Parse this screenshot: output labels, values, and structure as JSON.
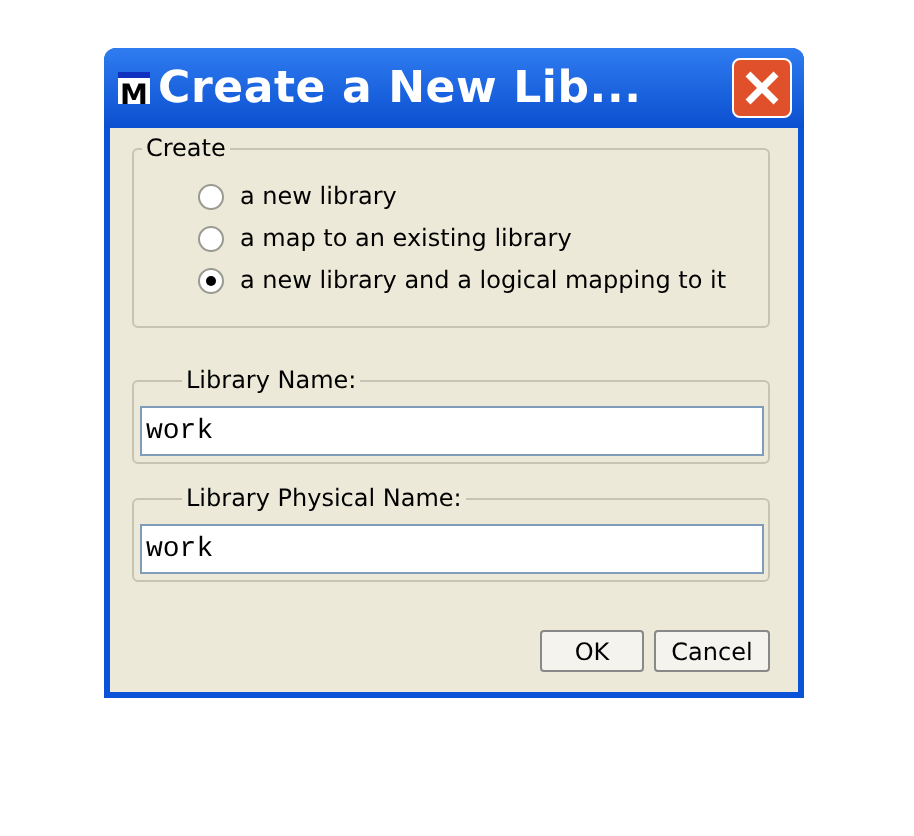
{
  "window": {
    "title": "Create a New Lib...",
    "icon_letter": "M"
  },
  "create_group": {
    "legend": "Create",
    "options": [
      {
        "label": "a new library",
        "selected": false
      },
      {
        "label": "a map to an existing library",
        "selected": false
      },
      {
        "label": "a new library and a logical mapping to it",
        "selected": true
      }
    ]
  },
  "fields": [
    {
      "legend": "Library Name:",
      "value": "work"
    },
    {
      "legend": "Library Physical Name:",
      "value": "work"
    }
  ],
  "buttons": [
    "OK",
    "Cancel"
  ]
}
